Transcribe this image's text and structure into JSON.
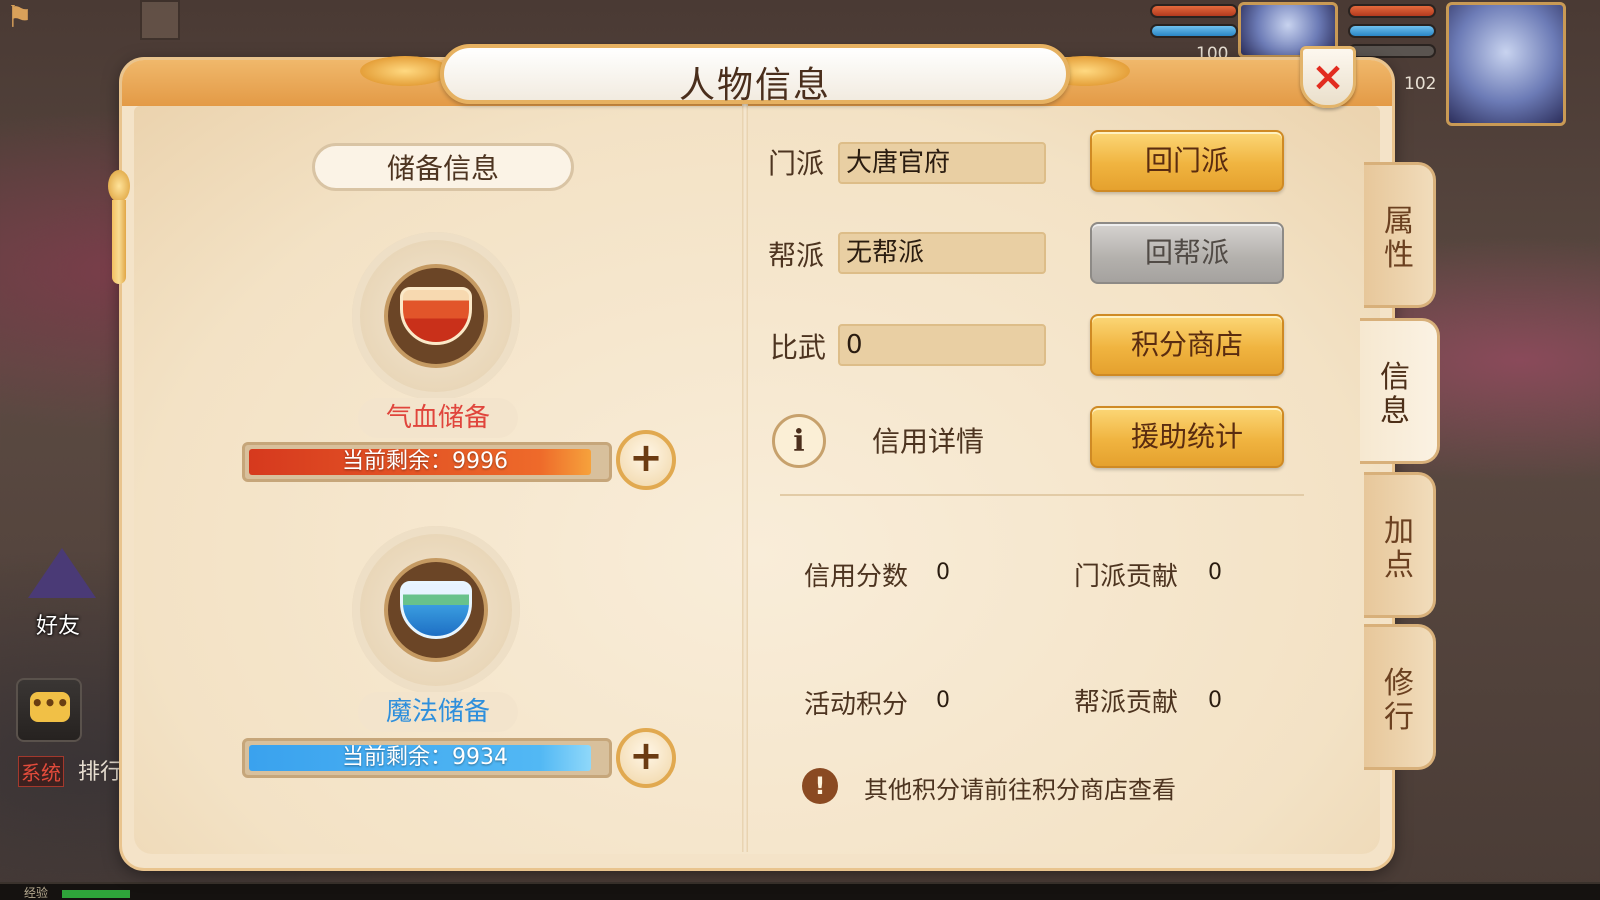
{
  "panel": {
    "title": "人物信息",
    "close_label": "×"
  },
  "reserve": {
    "section_title": "储备信息",
    "hp": {
      "label": "气血储备",
      "remaining_text": "当前剩余：9996",
      "remaining": 9996,
      "fill_fraction": 0.96
    },
    "mp": {
      "label": "魔法储备",
      "remaining_text": "当前剩余：9934",
      "remaining": 9934,
      "fill_fraction": 0.96
    },
    "plus_label": "+"
  },
  "fields": {
    "sect": {
      "label": "门派",
      "value": "大唐官府",
      "button": "回门派",
      "button_enabled": true
    },
    "guild": {
      "label": "帮派",
      "value": "无帮派",
      "button": "回帮派",
      "button_enabled": false
    },
    "arena": {
      "label": "比武",
      "value": "0",
      "button": "积分商店",
      "button_enabled": true
    }
  },
  "credit": {
    "info_icon": "i",
    "link_label": "信用详情",
    "assist_button": "援助统计"
  },
  "stats": {
    "credit_score": {
      "label": "信用分数",
      "value": "0"
    },
    "sect_contribution": {
      "label": "门派贡献",
      "value": "0"
    },
    "activity_points": {
      "label": "活动积分",
      "value": "0"
    },
    "guild_contribution": {
      "label": "帮派贡献",
      "value": "0"
    }
  },
  "notice": {
    "icon": "!",
    "text": "其他积分请前往积分商店查看"
  },
  "side_tabs": [
    {
      "label": "属性",
      "active": false
    },
    {
      "label": "信息",
      "active": true
    },
    {
      "label": "加点",
      "active": false
    },
    {
      "label": "修行",
      "active": false
    }
  ],
  "hud": {
    "pet_level": "100",
    "player_level": "102",
    "friend_label": "好友",
    "chat_icon": "•••",
    "system_tag": "系统",
    "system_text": "排行",
    "exp_label": "经验"
  },
  "colors": {
    "gold_button": "#f0b440",
    "gray_button": "#b3b0ac",
    "hp_bar": "#e2552a",
    "mp_bar": "#3aa2ee",
    "close_x": "#e22c1f",
    "hp_label": "#e0453c",
    "mp_label": "#2e8fdc"
  }
}
